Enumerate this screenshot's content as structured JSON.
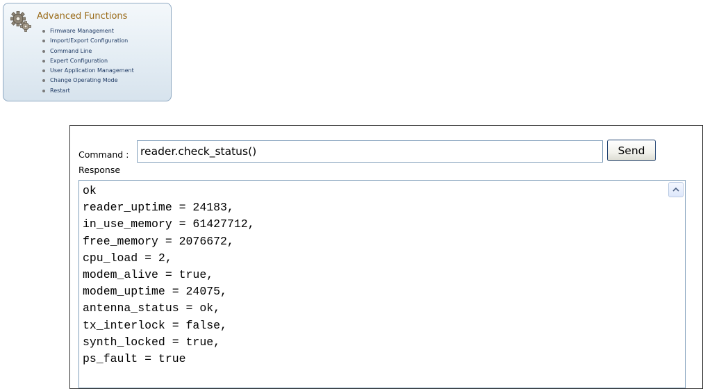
{
  "menu": {
    "title": "Advanced Functions",
    "icon": "gears-icon",
    "items": [
      {
        "label": "Firmware Management"
      },
      {
        "label": "Import/Export Configuration"
      },
      {
        "label": "Command Line"
      },
      {
        "label": "Expert Configuration"
      },
      {
        "label": "User Application Management"
      },
      {
        "label": "Change Operating Mode"
      },
      {
        "label": "Restart"
      }
    ]
  },
  "command_panel": {
    "command_label": "Command :",
    "command_value": "reader.check_status()",
    "send_label": "Send",
    "response_label": "Response",
    "response_text": "ok\nreader_uptime = 24183,\nin_use_memory = 61427712,\nfree_memory = 2076672,\ncpu_load = 2,\nmodem_alive = true,\nmodem_uptime = 24075,\nantenna_status = ok,\ntx_interlock = false,\nsynth_locked = true,\nps_fault = true"
  },
  "colors": {
    "menu_title": "#9a6a18",
    "menu_link": "#1f3a64",
    "menu_border": "#8fa9c2",
    "input_border": "#7f9db9"
  }
}
